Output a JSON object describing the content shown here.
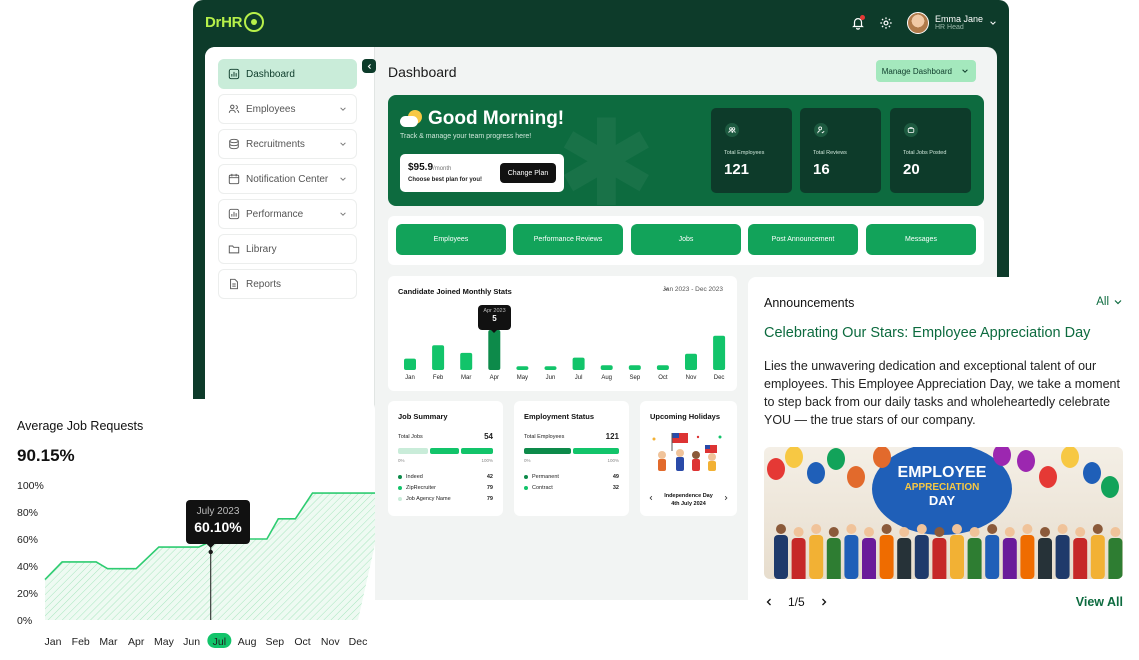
{
  "topbar": {
    "logo_text": "DrHR",
    "user_name": "Emma Jane",
    "user_role": "HR Head"
  },
  "sidebar": {
    "items": [
      {
        "label": "Dashboard",
        "icon": "chart-box-icon",
        "has_chevron": false,
        "active": true
      },
      {
        "label": "Employees",
        "icon": "users-icon",
        "has_chevron": true
      },
      {
        "label": "Recruitments",
        "icon": "database-icon",
        "has_chevron": true
      },
      {
        "label": "Notification Center",
        "icon": "calendar-icon",
        "has_chevron": true
      },
      {
        "label": "Performance",
        "icon": "chart-box-icon",
        "has_chevron": true
      },
      {
        "label": "Library",
        "icon": "folder-icon",
        "has_chevron": false
      },
      {
        "label": "Reports",
        "icon": "document-icon",
        "has_chevron": false
      }
    ]
  },
  "header": {
    "title": "Dashboard",
    "manage_label": "Manage Dashboard"
  },
  "hero": {
    "greeting": "Good Morning!",
    "subtitle": "Track & manage your team progress here!",
    "plan_price": "$95.9",
    "plan_period": "/month",
    "plan_note": "Choose best plan for you!",
    "plan_button": "Change Plan",
    "stats": [
      {
        "label": "Total Employees",
        "value": "121",
        "icon": "people-icon"
      },
      {
        "label": "Total Reviews",
        "value": "16",
        "icon": "person-check-icon"
      },
      {
        "label": "Total Jobs Posted",
        "value": "20",
        "icon": "briefcase-icon"
      }
    ]
  },
  "quick_actions": [
    "Employees",
    "Performance Reviews",
    "Jobs",
    "Post Announcement",
    "Messages"
  ],
  "monthly_stats": {
    "title": "Candidate Joined Monthly Stats",
    "range": "Jan 2023 - Dec 2023",
    "tooltip_month": "Apr 2023",
    "tooltip_value": "5",
    "chart_data": {
      "type": "bar",
      "categories": [
        "Jan",
        "Feb",
        "Mar",
        "Apr",
        "May",
        "Jun",
        "Jul",
        "Aug",
        "Sep",
        "Oct",
        "Nov",
        "Dec"
      ],
      "values": [
        1.2,
        2.6,
        1.8,
        4.2,
        0.4,
        0.4,
        1.3,
        0.5,
        0.5,
        0.5,
        1.7,
        3.6
      ],
      "highlight_index": 3,
      "color": "#12c46a",
      "highlight_color": "#0d8a4a"
    }
  },
  "job_summary": {
    "title": "Job Summary",
    "total_label": "Total Jobs",
    "total_value": "54",
    "axis_min": "0%",
    "axis_max": "100%",
    "rows": [
      {
        "label": "Indeed",
        "value": "42",
        "color": "#0d8a4a"
      },
      {
        "label": "ZipRecruiter",
        "value": "79",
        "color": "#12c46a"
      },
      {
        "label": "Job Agency Name",
        "value": "79",
        "color": "#c9ecd9"
      }
    ]
  },
  "employment_status": {
    "title": "Employment Status",
    "total_label": "Total Employees",
    "total_value": "121",
    "axis_min": "0%",
    "axis_max": "100%",
    "rows": [
      {
        "label": "Permanent",
        "value": "49",
        "color": "#0d8a4a"
      },
      {
        "label": "Contract",
        "value": "32",
        "color": "#12c46a"
      }
    ]
  },
  "holidays": {
    "title": "Upcoming Holidays",
    "name": "Independence Day",
    "date": "4th July 2024"
  },
  "announcements": {
    "title": "Announcements",
    "filter": "All",
    "headline": "Celebrating Our Stars: Employee Appreciation Day",
    "body": "Lies the unwavering dedication and exceptional talent of our employees. This Employee Appreciation Day, we take a moment to step back from our daily tasks and wholeheartedly celebrate YOU — the true stars of our company.",
    "banner_line1": "EMPLOYEE",
    "banner_line2": "APPRECIATION",
    "banner_line3": "DAY",
    "pager": "1/5",
    "view_all": "View All"
  },
  "job_requests": {
    "title": "Average Job Requests",
    "value": "90.15%",
    "tooltip_month": "July 2023",
    "tooltip_value": "60.10%",
    "chart_data": {
      "type": "area",
      "categories": [
        "Jan",
        "Feb",
        "Mar",
        "Apr",
        "May",
        "Jun",
        "Jul",
        "Aug",
        "Sep",
        "Oct",
        "Nov",
        "Dec"
      ],
      "y_ticks": [
        "100%",
        "80%",
        "60%",
        "40%",
        "20%",
        "0%"
      ],
      "ylim": [
        0,
        100
      ],
      "highlight_category": "Jul",
      "points": [
        [
          0,
          30
        ],
        [
          0.6,
          43
        ],
        [
          1.8,
          43
        ],
        [
          2.2,
          38
        ],
        [
          3.2,
          38
        ],
        [
          4.0,
          54
        ],
        [
          5.4,
          54
        ],
        [
          6.0,
          60
        ],
        [
          7.8,
          60
        ],
        [
          8.2,
          75
        ],
        [
          8.8,
          75
        ],
        [
          9.4,
          94
        ],
        [
          12.0,
          94
        ]
      ],
      "color": "#2ecc71"
    }
  }
}
